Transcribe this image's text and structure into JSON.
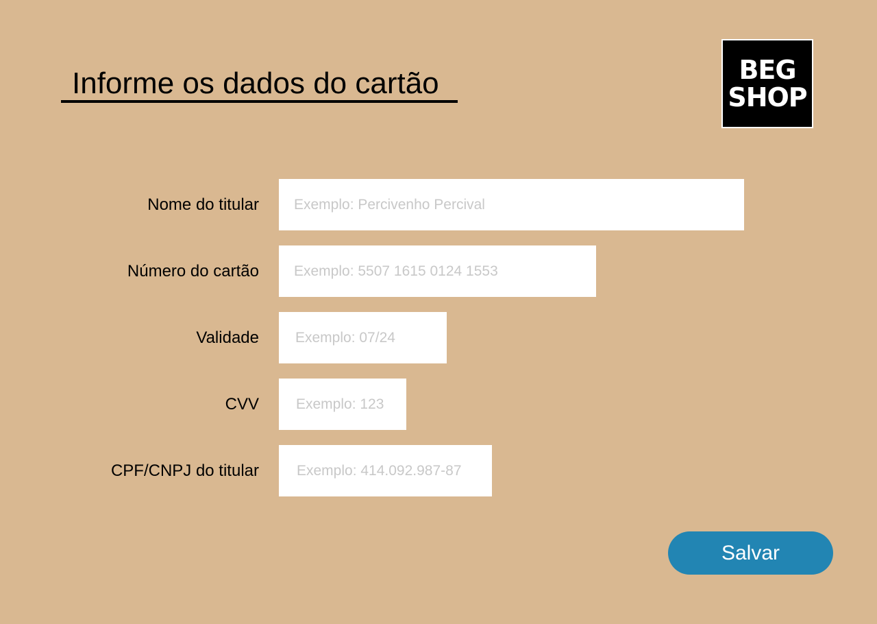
{
  "header": {
    "title": "Informe os dados do cartão"
  },
  "logo": {
    "line1": "BEG",
    "line2": "SHOP"
  },
  "form": {
    "holder_name": {
      "label": "Nome do titular",
      "placeholder": "Exemplo: Percivenho Percival"
    },
    "card_number": {
      "label": "Número do cartão",
      "placeholder": "Exemplo: 5507 1615 0124 1553"
    },
    "expiry": {
      "label": "Validade",
      "placeholder": "Exemplo: 07/24"
    },
    "cvv": {
      "label": "CVV",
      "placeholder": "Exemplo: 123"
    },
    "document": {
      "label": "CPF/CNPJ do titular",
      "placeholder": "Exemplo: 414.092.987-87"
    },
    "save_label": "Salvar"
  },
  "colors": {
    "background": "#d9b891",
    "button": "#2285b3",
    "logo_background": "#000000"
  }
}
